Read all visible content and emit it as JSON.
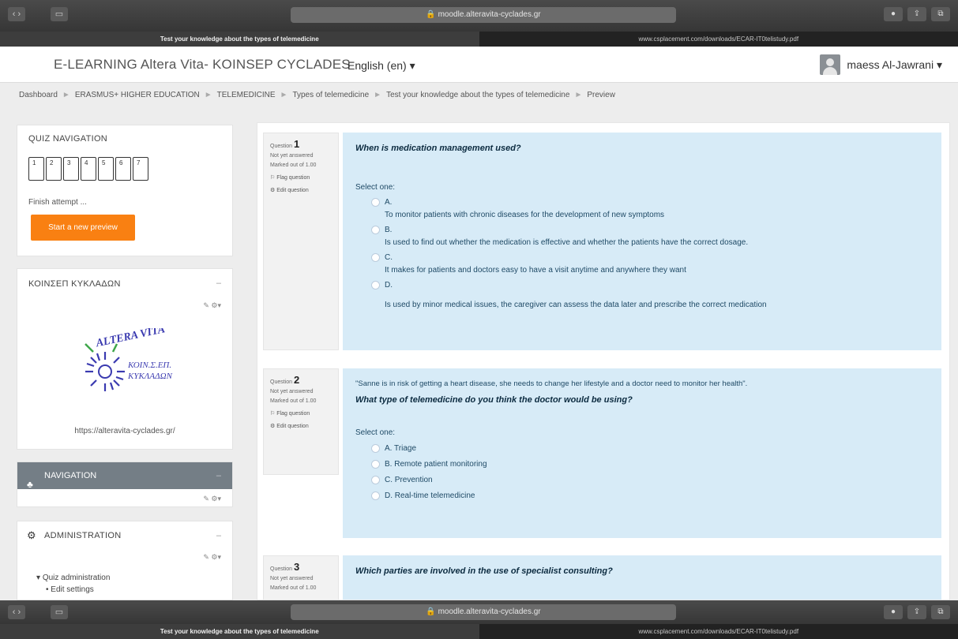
{
  "browser": {
    "address": "moodle.alteravita-cyclades.gr",
    "tab_active": "Test your knowledge about the types of telemedicine",
    "tab_other": "www.csplacement.com/downloads/ECAR-IT0telistudy.pdf"
  },
  "header": {
    "site_title": "E-LEARNING Altera Vita- KOINSEP CYCLADES",
    "language": "English (en) ▾",
    "user_name": "maess Al-Jawrani ▾"
  },
  "breadcrumb": [
    "Dashboard",
    "ERASMUS+ HIGHER EDUCATION",
    "TELEMEDICINE",
    "Types of telemedicine",
    "Test your knowledge about the types of telemedicine",
    "Preview"
  ],
  "quiz_nav": {
    "title": "QUIZ NAVIGATION",
    "buttons": [
      "1",
      "2",
      "3",
      "4",
      "5",
      "6",
      "7"
    ],
    "finish": "Finish attempt ...",
    "start_new": "Start a new preview"
  },
  "koinsep": {
    "title": "ΚΟΙΝΣΕΠ ΚΥΚΛΑΔΩΝ",
    "logo_text_top": "ALTERA VITA",
    "logo_text_right1": "ΚΟΙΝ.Σ.ΕΠ.",
    "logo_text_right2": "ΚΥΚΛΑΔΩΝ",
    "url": "https://alteravita-cyclades.gr/"
  },
  "navigation": {
    "title": "NAVIGATION"
  },
  "administration": {
    "title": "ADMINISTRATION",
    "item": "Quiz administration",
    "sub_item": "Edit settings"
  },
  "questions": [
    {
      "label": "Question",
      "number": "1",
      "status": "Not yet answered",
      "marked": "Marked out of 1.00",
      "flag": "Flag question",
      "edit": "Edit question",
      "text": "When is medication management used?",
      "select_one": "Select one:",
      "options": [
        {
          "letter": "A.",
          "text": "To monitor patients with chronic diseases for the development of new symptoms"
        },
        {
          "letter": "B.",
          "text": "Is used to find out whether the medication is effective and whether the patients have the correct dosage."
        },
        {
          "letter": "C.",
          "text": "It makes for patients and doctors easy to have a visit anytime and anywhere they want"
        },
        {
          "letter": "D.",
          "text": "Is used by minor medical issues, the caregiver can assess the data later and prescribe the correct medication"
        }
      ]
    },
    {
      "label": "Question",
      "number": "2",
      "status": "Not yet answered",
      "marked": "Marked out of 1.00",
      "flag": "Flag question",
      "edit": "Edit question",
      "pre_text": "\"Sanne is in risk of getting a heart disease, she needs to change her lifestyle and a doctor need to monitor her health\".",
      "text": "What type of telemedicine do you think the doctor would be using?",
      "select_one": "Select one:",
      "options": [
        "A. Triage",
        "B. Remote patient monitoring",
        "C. Prevention",
        "D. Real-time telemedicine"
      ]
    },
    {
      "label": "Question",
      "number": "3",
      "status": "Not yet answered",
      "marked": "Marked out of 1.00",
      "text": "Which parties are involved in the use of specialist consulting?"
    }
  ]
}
